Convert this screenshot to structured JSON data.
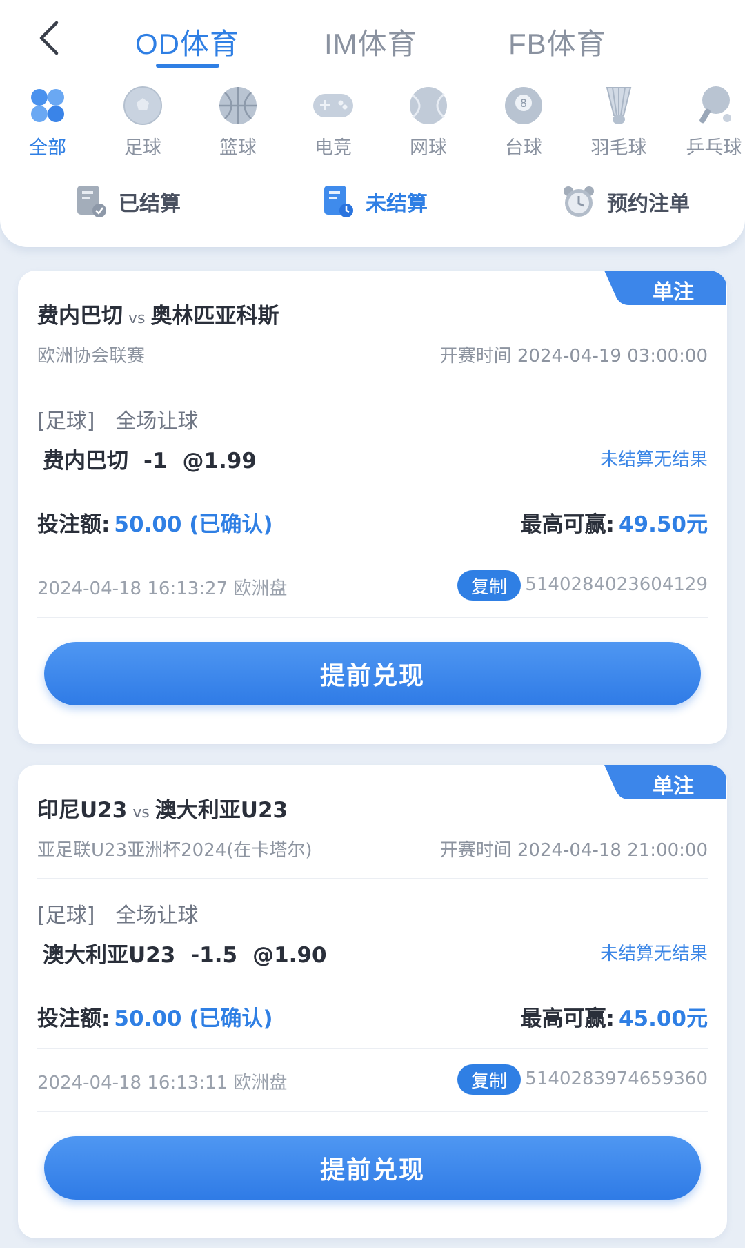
{
  "header": {
    "tabs": [
      {
        "label": "OD体育",
        "active": true
      },
      {
        "label": "IM体育",
        "active": false
      },
      {
        "label": "FB体育",
        "active": false
      }
    ],
    "sports": [
      {
        "label": "全部",
        "icon": "all-grid-icon",
        "active": true
      },
      {
        "label": "足球",
        "icon": "soccer-ball-icon",
        "active": false
      },
      {
        "label": "篮球",
        "icon": "basketball-icon",
        "active": false
      },
      {
        "label": "电竞",
        "icon": "gamepad-icon",
        "active": false
      },
      {
        "label": "网球",
        "icon": "tennis-ball-icon",
        "active": false
      },
      {
        "label": "台球",
        "icon": "billiard-ball-icon",
        "active": false
      },
      {
        "label": "羽毛球",
        "icon": "shuttlecock-icon",
        "active": false
      },
      {
        "label": "乒乓球",
        "icon": "ping-pong-icon",
        "active": false
      }
    ],
    "filters": [
      {
        "label": "已结算",
        "icon": "settled-doc-icon",
        "active": false
      },
      {
        "label": "未结算",
        "icon": "unsettled-doc-icon",
        "active": true
      },
      {
        "label": "预约注单",
        "icon": "alarm-clock-icon",
        "active": false
      }
    ]
  },
  "colors": {
    "accent": "#2f7fe4",
    "background": "#e8eef6",
    "inactive": "#8a92a0"
  },
  "bets": [
    {
      "badge": "单注",
      "home": "费内巴切",
      "vs": "vs",
      "away": "奥林匹亚科斯",
      "league": "欧洲协会联赛",
      "start_time": "开赛时间 2024-04-19 03:00:00",
      "sport": "[足球]",
      "market": "全场让球",
      "pick_team": "费内巴切",
      "pick_line": "-1",
      "pick_odds": "@1.99",
      "status": "未结算无结果",
      "stake_label": "投注额:",
      "stake_value": "50.00 (已确认)",
      "maxwin_label": "最高可赢:",
      "maxwin_value": "49.50元",
      "placed_at": "2024-04-18 16:13:27 欧洲盘",
      "copy_label": "复制",
      "order_no": "5140284023604129",
      "cashout_label": "提前兑现"
    },
    {
      "badge": "单注",
      "home": "印尼U23",
      "vs": "vs",
      "away": "澳大利亚U23",
      "league": "亚足联U23亚洲杯2024(在卡塔尔)",
      "start_time": "开赛时间 2024-04-18 21:00:00",
      "sport": "[足球]",
      "market": "全场让球",
      "pick_team": "澳大利亚U23",
      "pick_line": "-1.5",
      "pick_odds": "@1.90",
      "status": "未结算无结果",
      "stake_label": "投注额:",
      "stake_value": "50.00 (已确认)",
      "maxwin_label": "最高可赢:",
      "maxwin_value": "45.00元",
      "placed_at": "2024-04-18 16:13:11 欧洲盘",
      "copy_label": "复制",
      "order_no": "5140283974659360",
      "cashout_label": "提前兑现"
    }
  ]
}
